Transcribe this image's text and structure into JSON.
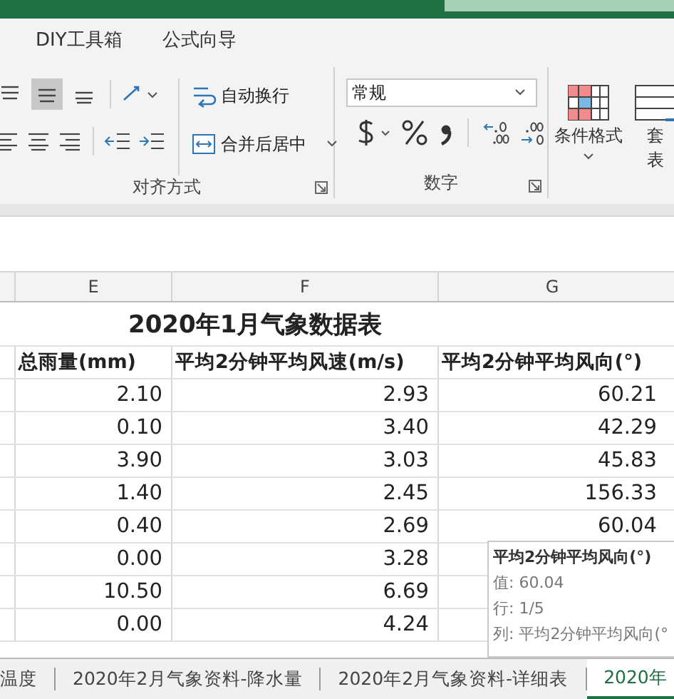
{
  "menu_tabs": [
    {
      "label": "DIY工具箱",
      "selected": false
    },
    {
      "label": "公式向导",
      "selected": false
    }
  ],
  "alignment": {
    "vertical": [
      {
        "kind": "top",
        "selected": false
      },
      {
        "kind": "middle",
        "selected": true
      },
      {
        "kind": "bottom",
        "selected": false
      }
    ],
    "wrap_text": "自动换行",
    "merge_center": "合并后居中",
    "label": "对齐方式"
  },
  "number": {
    "format": "常规",
    "label": "数字"
  },
  "styles": {
    "conditional_format": "条件格式",
    "table_format_top": "套",
    "table_format_bottom": "表"
  },
  "columns": [
    "E",
    "F",
    "G"
  ],
  "sheet_title": "2020年1月气象数据表",
  "headers": [
    "总雨量(mm)",
    "平均2分钟平均风速(m/s)",
    "平均2分钟平均风向(°)"
  ],
  "rows": [
    [
      "2.10",
      "2.93",
      "60.21"
    ],
    [
      "0.10",
      "3.40",
      "42.29"
    ],
    [
      "3.90",
      "3.03",
      "45.83"
    ],
    [
      "1.40",
      "2.45",
      "156.33"
    ],
    [
      "0.40",
      "2.69",
      "60.04"
    ],
    [
      "0.00",
      "3.28",
      ""
    ],
    [
      "10.50",
      "6.69",
      ""
    ],
    [
      "0.00",
      "4.24",
      ""
    ]
  ],
  "tooltip": {
    "title": "平均2分钟平均风向(°)",
    "lines": [
      "值: 60.04",
      "行: 1/5",
      "列: 平均2分钟平均风向(°"
    ]
  },
  "sheet_tabs": [
    {
      "label": "温度",
      "selected": false
    },
    {
      "label": "2020年2月气象资料-降水量",
      "selected": false
    },
    {
      "label": "2020年2月气象资料-详细表",
      "selected": false
    },
    {
      "label": "2020年",
      "selected": true
    }
  ]
}
